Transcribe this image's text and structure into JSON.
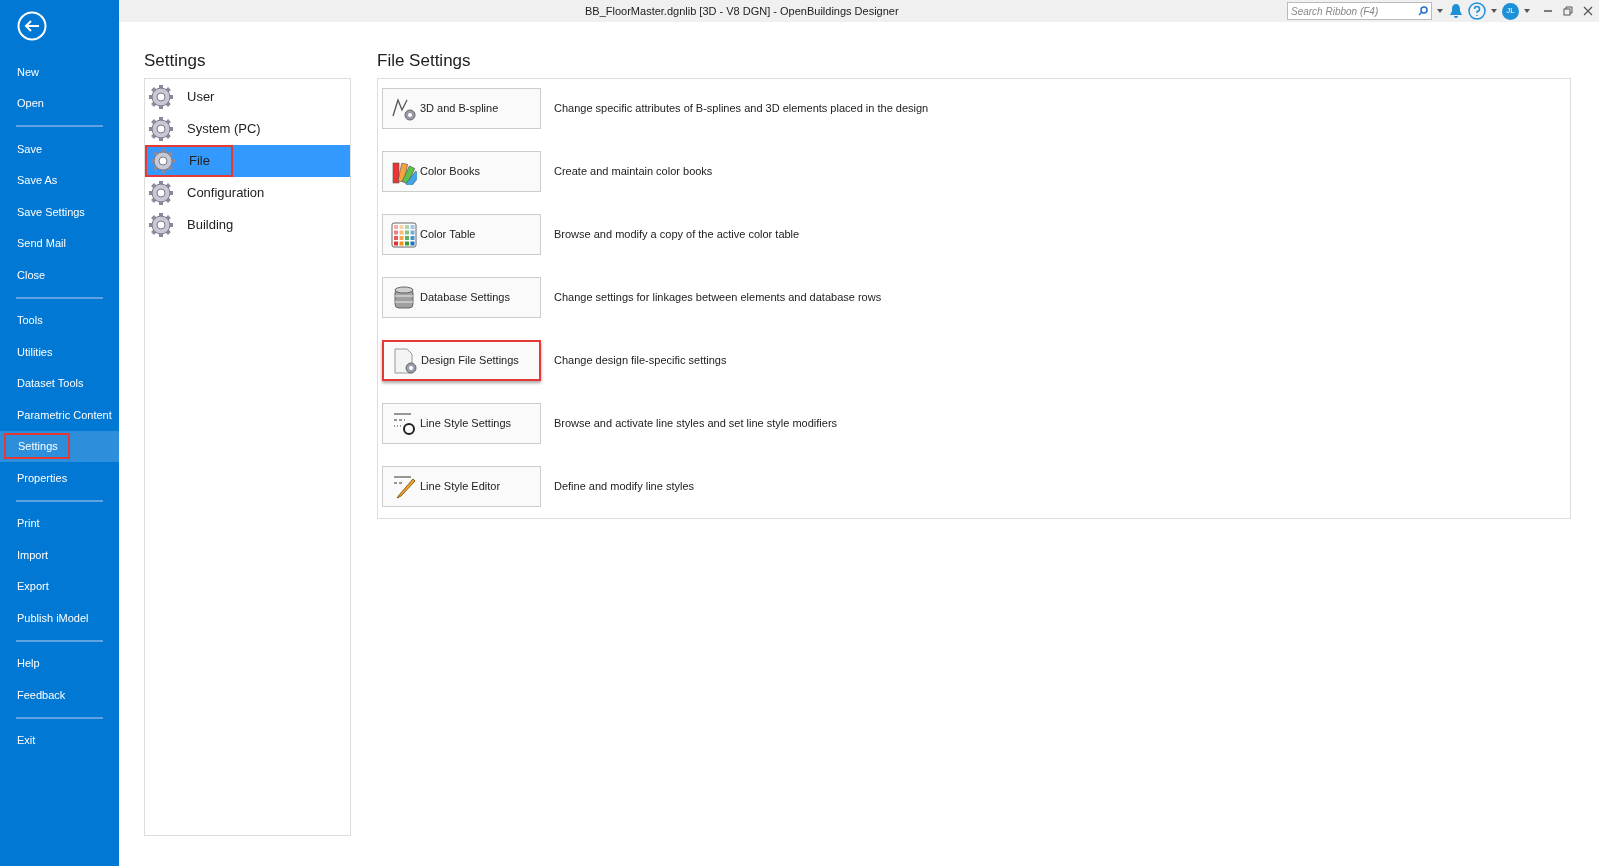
{
  "window": {
    "title": "BB_FloorMaster.dgnlib [3D - V8 DGN] - OpenBuildings Designer",
    "search": {
      "placeholder": "Search Ribbon (F4)"
    },
    "user_initials": "JL"
  },
  "sidebar": {
    "groups": [
      [
        {
          "label": "New",
          "selected": false,
          "annotated": false
        },
        {
          "label": "Open",
          "selected": false,
          "annotated": false
        }
      ],
      [
        {
          "label": "Save",
          "selected": false,
          "annotated": false
        },
        {
          "label": "Save As",
          "selected": false,
          "annotated": false
        },
        {
          "label": "Save Settings",
          "selected": false,
          "annotated": false
        },
        {
          "label": "Send Mail",
          "selected": false,
          "annotated": false
        },
        {
          "label": "Close",
          "selected": false,
          "annotated": false
        }
      ],
      [
        {
          "label": "Tools",
          "selected": false,
          "annotated": false
        },
        {
          "label": "Utilities",
          "selected": false,
          "annotated": false
        },
        {
          "label": "Dataset Tools",
          "selected": false,
          "annotated": false
        },
        {
          "label": "Parametric Content",
          "selected": false,
          "annotated": false
        },
        {
          "label": "Settings",
          "selected": true,
          "annotated": true
        },
        {
          "label": "Properties",
          "selected": false,
          "annotated": false
        }
      ],
      [
        {
          "label": "Print",
          "selected": false,
          "annotated": false
        },
        {
          "label": "Import",
          "selected": false,
          "annotated": false
        },
        {
          "label": "Export",
          "selected": false,
          "annotated": false
        },
        {
          "label": "Publish iModel",
          "selected": false,
          "annotated": false
        }
      ],
      [
        {
          "label": "Help",
          "selected": false,
          "annotated": false
        },
        {
          "label": "Feedback",
          "selected": false,
          "annotated": false
        }
      ],
      [
        {
          "label": "Exit",
          "selected": false,
          "annotated": false
        }
      ]
    ]
  },
  "settings": {
    "title": "Settings",
    "categories": [
      {
        "label": "User",
        "selected": false,
        "annotated": false
      },
      {
        "label": "System (PC)",
        "selected": false,
        "annotated": false
      },
      {
        "label": "File",
        "selected": true,
        "annotated": true
      },
      {
        "label": "Configuration",
        "selected": false,
        "annotated": false
      },
      {
        "label": "Building",
        "selected": false,
        "annotated": false
      }
    ]
  },
  "file_settings": {
    "title": "File Settings",
    "items": [
      {
        "kind": "spline",
        "label": "3D and B-spline",
        "description": "Change specific attributes of B-splines and 3D elements placed in the design",
        "annotated": false
      },
      {
        "kind": "colorbooks",
        "label": "Color Books",
        "description": "Create and maintain color books",
        "annotated": false
      },
      {
        "kind": "colortable",
        "label": "Color Table",
        "description": "Browse and modify a copy of the active color table",
        "annotated": false
      },
      {
        "kind": "database",
        "label": "Database Settings",
        "description": "Change settings for linkages between elements and database rows",
        "annotated": false
      },
      {
        "kind": "designfile",
        "label": "Design File Settings",
        "description": "Change design file-specific settings",
        "annotated": true
      },
      {
        "kind": "linestyle",
        "label": "Line Style Settings",
        "description": "Browse and activate line styles and set line style modifiers",
        "annotated": false
      },
      {
        "kind": "lineeditor",
        "label": "Line Style Editor",
        "description": "Define and modify line styles",
        "annotated": false
      }
    ]
  }
}
